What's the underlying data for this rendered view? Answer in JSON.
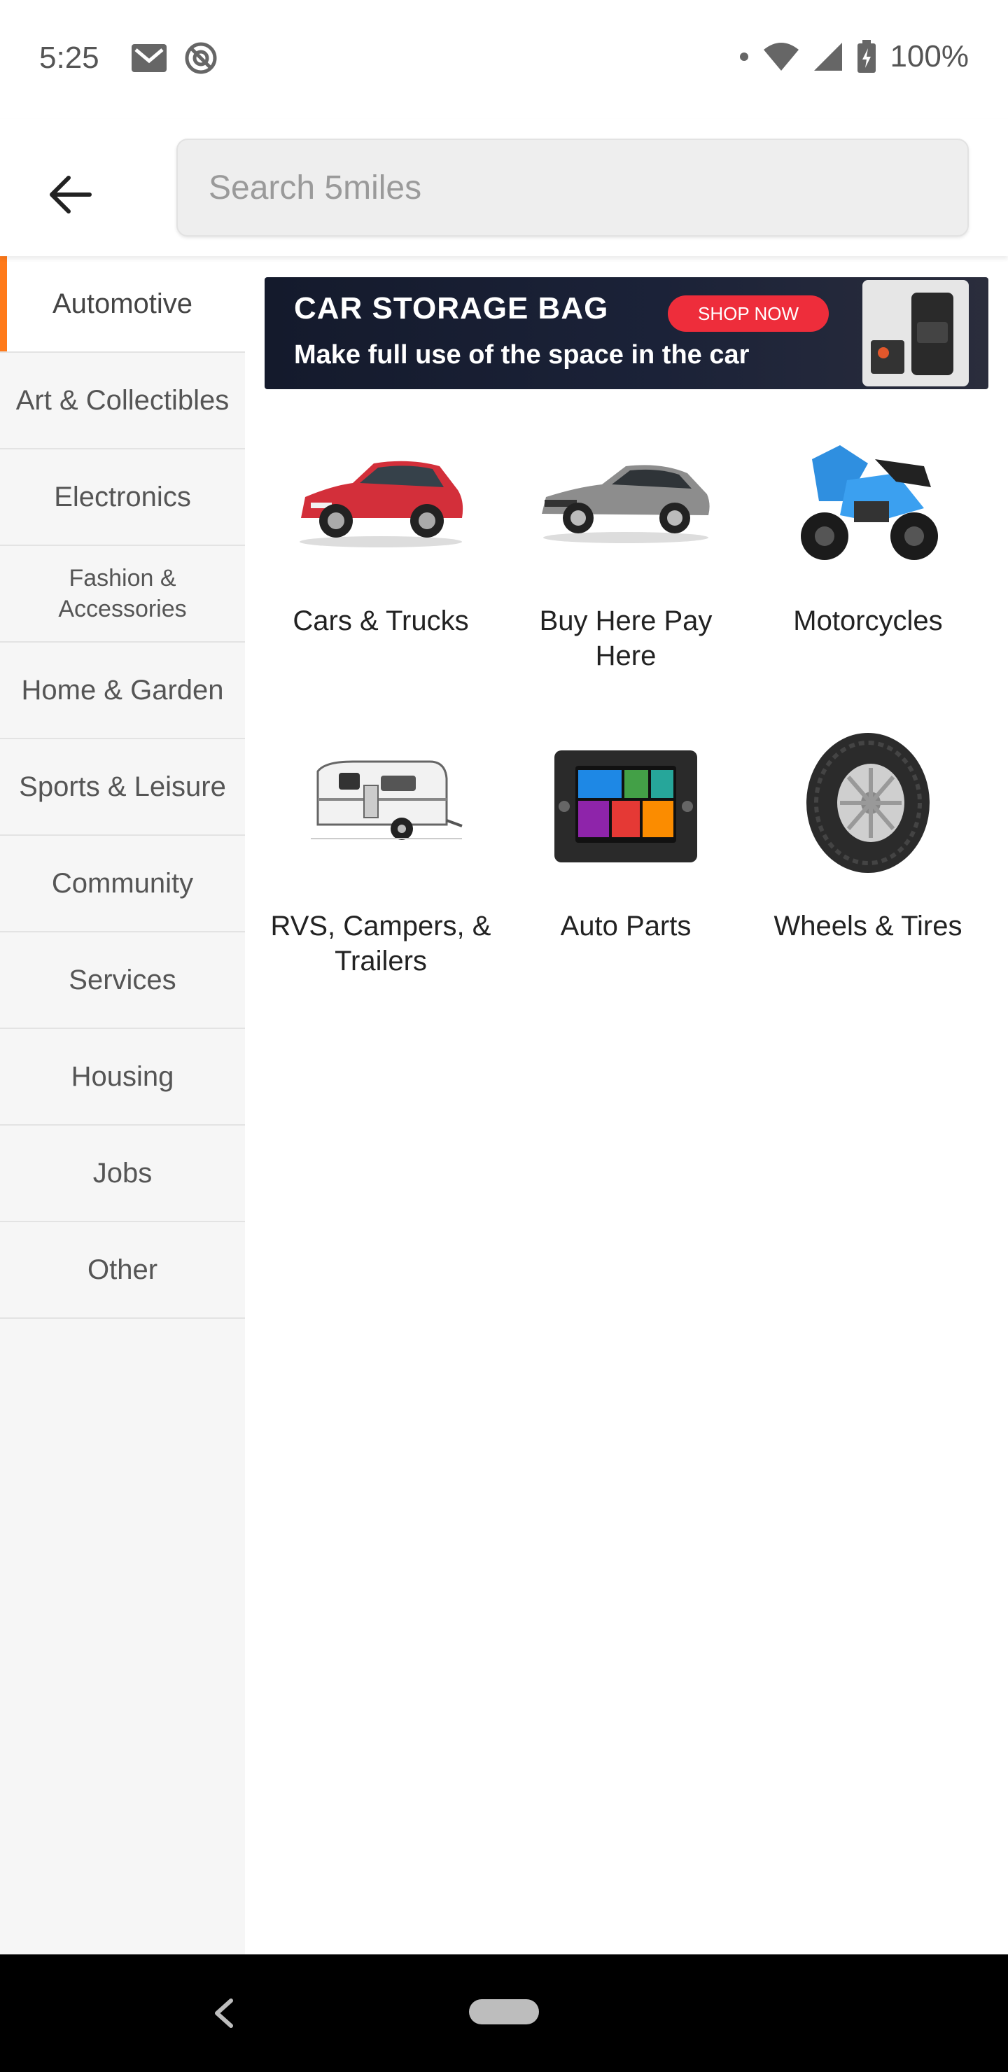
{
  "status_bar": {
    "time": "5:25",
    "battery": "100%"
  },
  "header": {
    "search_placeholder": "Search 5miles"
  },
  "sidebar": {
    "accent_color": "#ff7a1a",
    "items": [
      {
        "label": "Automotive",
        "active": true
      },
      {
        "label": "Art & Collectibles"
      },
      {
        "label": "Electronics"
      },
      {
        "label": "Fashion & Accessories"
      },
      {
        "label": "Home & Garden"
      },
      {
        "label": "Sports & Leisure"
      },
      {
        "label": "Community"
      },
      {
        "label": "Services"
      },
      {
        "label": "Housing"
      },
      {
        "label": "Jobs"
      },
      {
        "label": "Other"
      }
    ]
  },
  "banner": {
    "title": "CAR STORAGE BAG",
    "subtitle": "Make full use of the space in the car",
    "cta": "SHOP NOW"
  },
  "categories": [
    {
      "label": "Cars & Trucks",
      "icon": "car-icon"
    },
    {
      "label": "Buy Here Pay Here",
      "icon": "sedan-icon"
    },
    {
      "label": "Motorcycles",
      "icon": "motorcycle-icon"
    },
    {
      "label": "RVS, Campers, & Trailers",
      "icon": "camper-icon"
    },
    {
      "label": "Auto Parts",
      "icon": "car-stereo-icon"
    },
    {
      "label": "Wheels & Tires",
      "icon": "tire-icon"
    }
  ]
}
